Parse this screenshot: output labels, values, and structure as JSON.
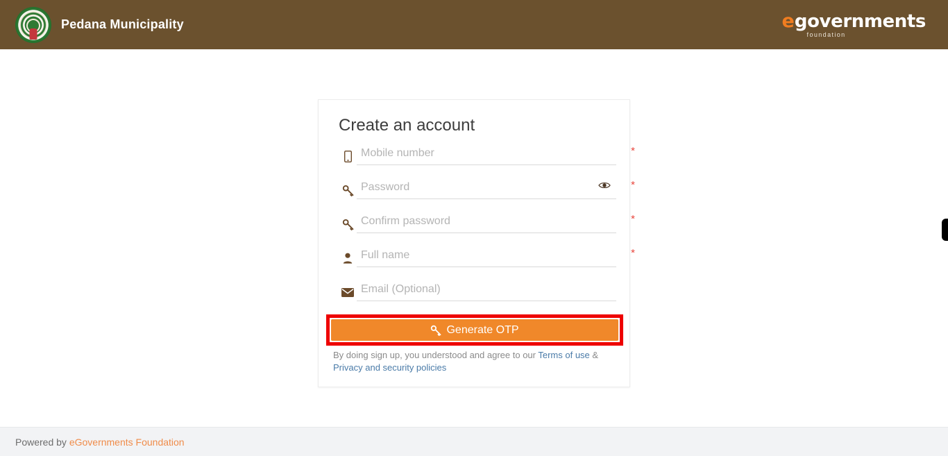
{
  "header": {
    "municipality_title": "Pedana Municipality",
    "emblem_icon": "andhra-pradesh-state-emblem",
    "logo": {
      "e": "e",
      "word": "governments",
      "sub": "foundation"
    }
  },
  "card": {
    "title": "Create an account",
    "fields": [
      {
        "icon": "mobile-phone-icon",
        "placeholder": "Mobile number",
        "value": "",
        "required_mark": "*",
        "type": "tel"
      },
      {
        "icon": "key-icon",
        "placeholder": "Password",
        "value": "",
        "required_mark": "*",
        "type": "password",
        "toggle_icon": "eye-icon"
      },
      {
        "icon": "key-icon",
        "placeholder": "Confirm password",
        "value": "",
        "required_mark": "*",
        "type": "password"
      },
      {
        "icon": "person-icon",
        "placeholder": "Full name",
        "value": "",
        "required_mark": "*",
        "type": "text"
      },
      {
        "icon": "envelope-icon",
        "placeholder": "Email (Optional)",
        "value": "",
        "required_mark": "",
        "type": "email"
      }
    ],
    "submit": {
      "label": "Generate OTP",
      "icon": "key-icon",
      "bg_color": "#f0882a",
      "text_color": "#ffffff",
      "annotation_color": "#ee0000"
    },
    "terms": {
      "prefix": "By doing sign up, you understood and agree to our ",
      "link1": "Terms of use",
      "separator": " & ",
      "link2": "Privacy and security policies",
      "link_color": "#4a7ba8"
    }
  },
  "footer": {
    "prefix": "Powered by ",
    "link": "eGovernments Foundation",
    "link_color": "#f08c4a"
  },
  "edge_tab": {
    "name": "right-edge-handle"
  },
  "colors": {
    "header_bg": "#6b512e",
    "accent_orange": "#f0882a",
    "required_red": "#e8453c",
    "footer_bg": "#f2f3f5"
  }
}
